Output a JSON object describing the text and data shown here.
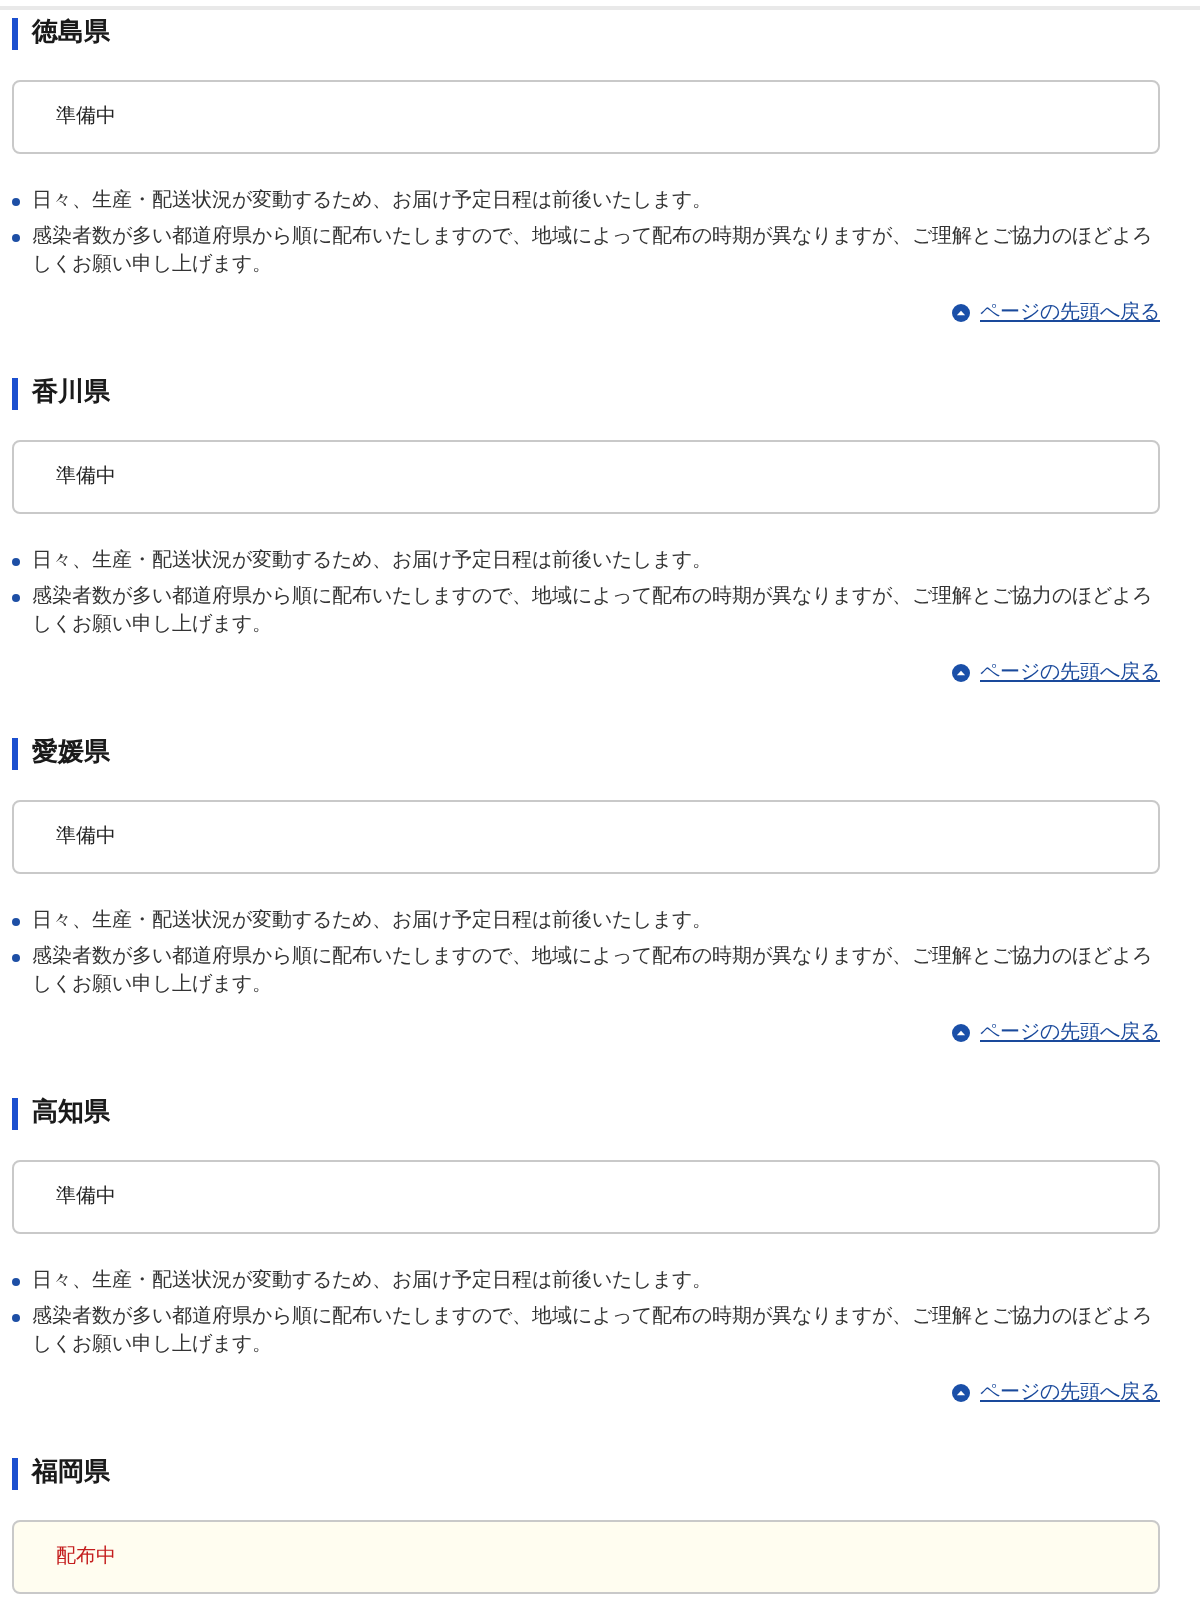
{
  "sections": [
    {
      "prefecture": "徳島県",
      "status": {
        "label": "準備中",
        "kind": "preparing"
      },
      "notes": [
        "日々、生産・配送状況が変動するため、お届け予定日程は前後いたします。",
        "感染者数が多い都道府県から順に配布いたしますので、地域によって配布の時期が異なりますが、ご理解とご協力のほどよろしくお願い申し上げます。"
      ],
      "back_to_top_link": "ページの先頭へ戻る"
    },
    {
      "prefecture": "香川県",
      "status": {
        "label": "準備中",
        "kind": "preparing"
      },
      "notes": [
        "日々、生産・配送状況が変動するため、お届け予定日程は前後いたします。",
        "感染者数が多い都道府県から順に配布いたしますので、地域によって配布の時期が異なりますが、ご理解とご協力のほどよろしくお願い申し上げます。"
      ],
      "back_to_top_link": "ページの先頭へ戻る"
    },
    {
      "prefecture": "愛媛県",
      "status": {
        "label": "準備中",
        "kind": "preparing"
      },
      "notes": [
        "日々、生産・配送状況が変動するため、お届け予定日程は前後いたします。",
        "感染者数が多い都道府県から順に配布いたしますので、地域によって配布の時期が異なりますが、ご理解とご協力のほどよろしくお願い申し上げます。"
      ],
      "back_to_top_link": "ページの先頭へ戻る"
    },
    {
      "prefecture": "高知県",
      "status": {
        "label": "準備中",
        "kind": "preparing"
      },
      "notes": [
        "日々、生産・配送状況が変動するため、お届け予定日程は前後いたします。",
        "感染者数が多い都道府県から順に配布いたしますので、地域によって配布の時期が異なりますが、ご理解とご協力のほどよろしくお願い申し上げます。"
      ],
      "back_to_top_link": "ページの先頭へ戻る"
    },
    {
      "prefecture": "福岡県",
      "status": {
        "label": "配布中",
        "kind": "distributing"
      }
    }
  ]
}
